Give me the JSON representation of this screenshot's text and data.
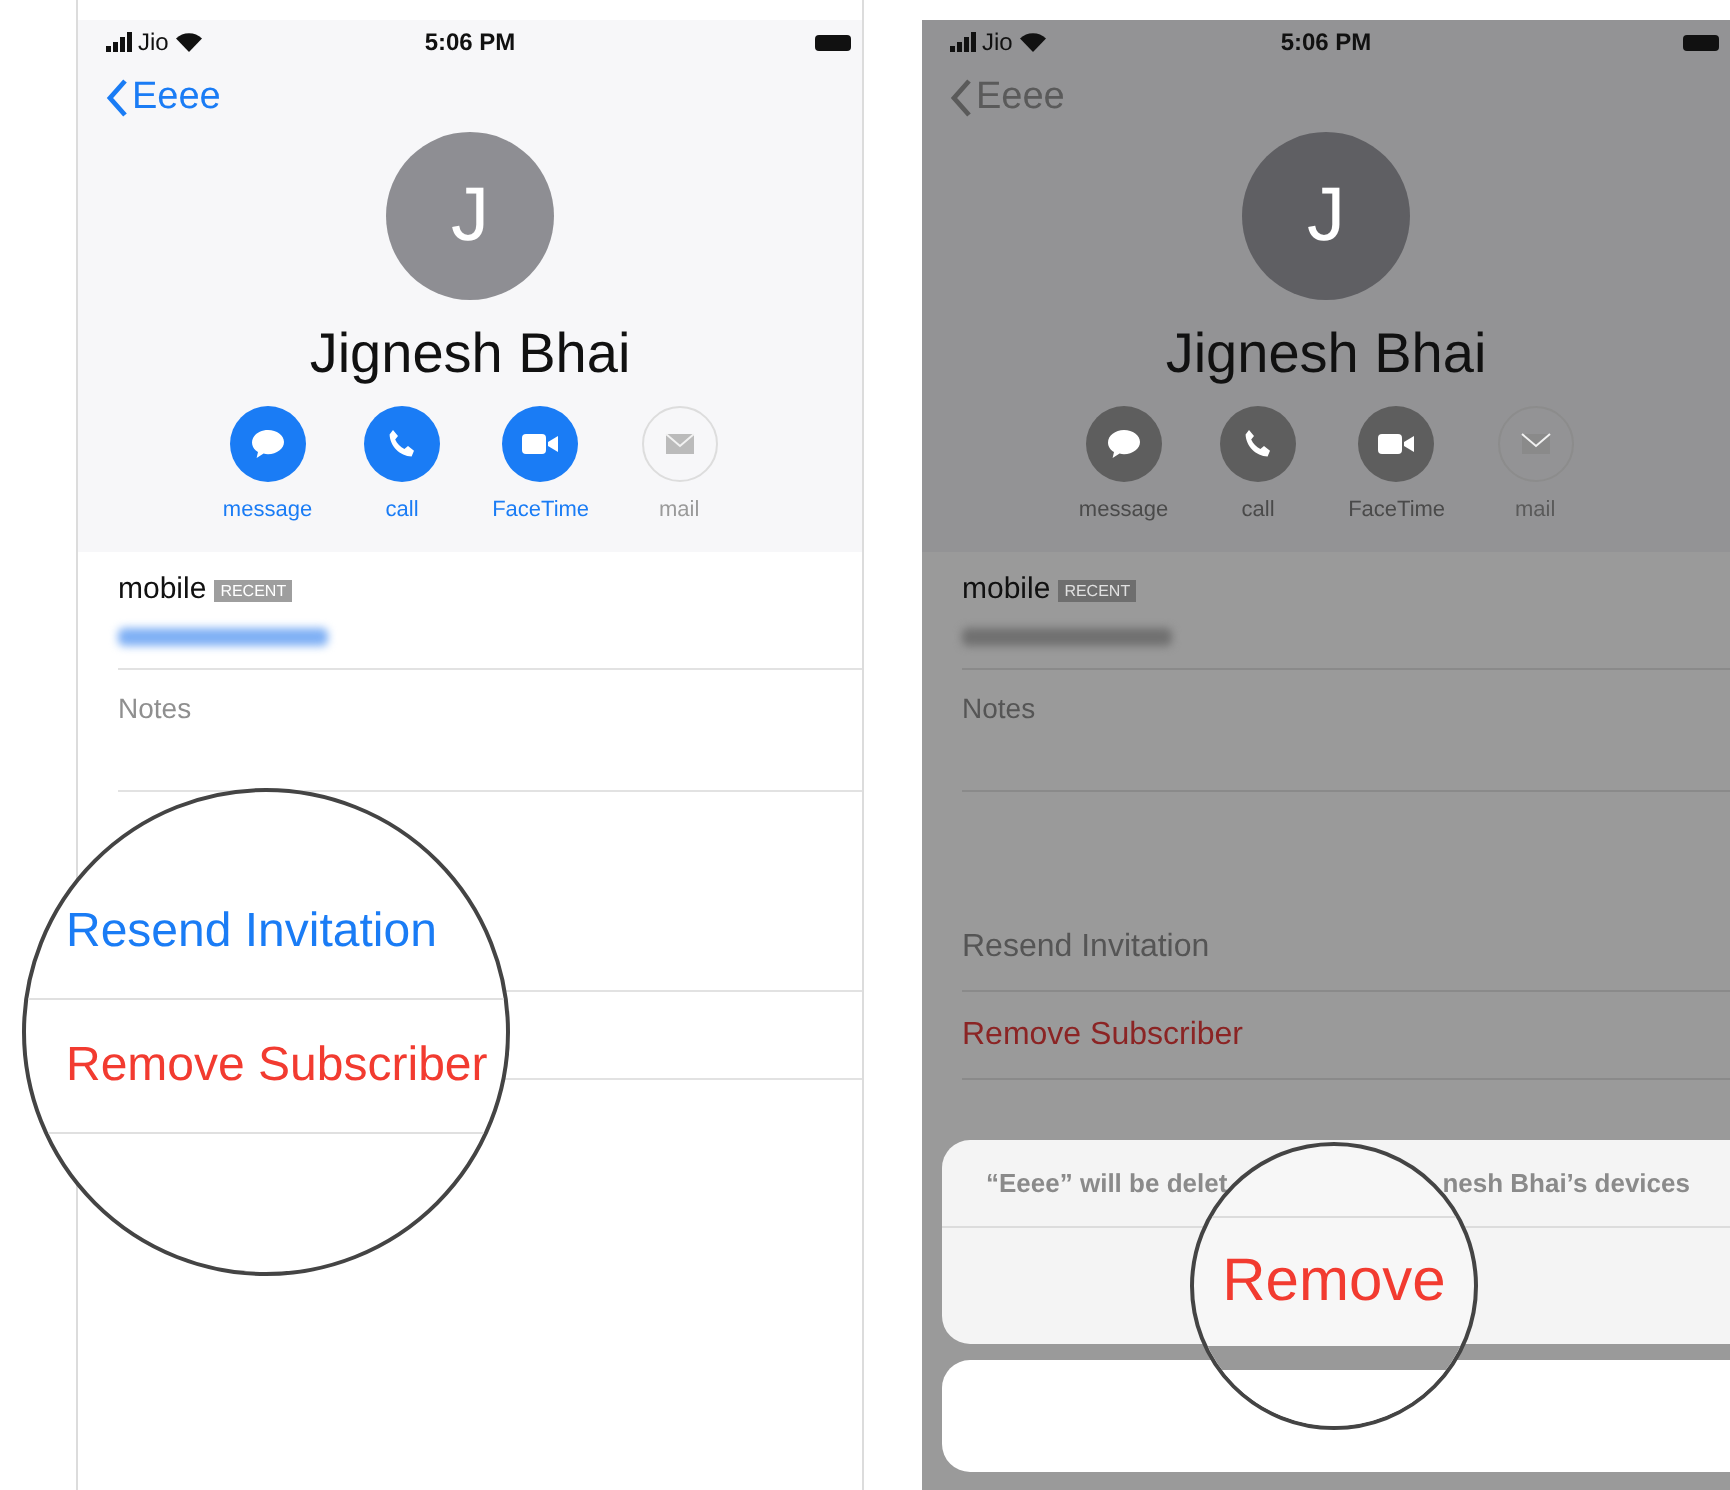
{
  "screens": [
    {
      "dimmed": false,
      "status_bar": {
        "carrier": "Jio",
        "time": "5:06 PM"
      },
      "back_label": "Eeee",
      "avatar_initial": "J",
      "name": "Jignesh Bhai",
      "actions": [
        {
          "label": "message",
          "kind": "message",
          "enabled": true
        },
        {
          "label": "call",
          "kind": "call",
          "enabled": true
        },
        {
          "label": "FaceTime",
          "kind": "facetime",
          "enabled": true
        },
        {
          "label": "mail",
          "kind": "mail",
          "enabled": false
        }
      ],
      "phone": {
        "label": "mobile",
        "badge": "RECENT"
      },
      "notes_label": "Notes",
      "magnifier": {
        "kind": "list",
        "rows": [
          {
            "label": "Resend Invitation",
            "kind": "default"
          },
          {
            "label": "Remove Subscriber",
            "kind": "destructive"
          }
        ]
      }
    },
    {
      "dimmed": true,
      "status_bar": {
        "carrier": "Jio",
        "time": "5:06 PM"
      },
      "back_label": "Eeee",
      "avatar_initial": "J",
      "name": "Jignesh Bhai",
      "actions": [
        {
          "label": "message",
          "kind": "message",
          "enabled": true
        },
        {
          "label": "call",
          "kind": "call",
          "enabled": true
        },
        {
          "label": "FaceTime",
          "kind": "facetime",
          "enabled": true
        },
        {
          "label": "mail",
          "kind": "mail",
          "enabled": false
        }
      ],
      "phone": {
        "label": "mobile",
        "badge": "RECENT"
      },
      "notes_label": "Notes",
      "list_rows": [
        {
          "label": "Resend Invitation",
          "kind": "default"
        },
        {
          "label": "Remove Subscriber",
          "kind": "destructive"
        }
      ],
      "action_sheet": {
        "message_parts": [
          "“Eeee” will be delet",
          "nesh Bhai’s devices"
        ]
      },
      "magnifier": {
        "kind": "sheet",
        "rows": [
          {
            "label": "Remove",
            "kind": "destructive"
          }
        ]
      }
    }
  ]
}
